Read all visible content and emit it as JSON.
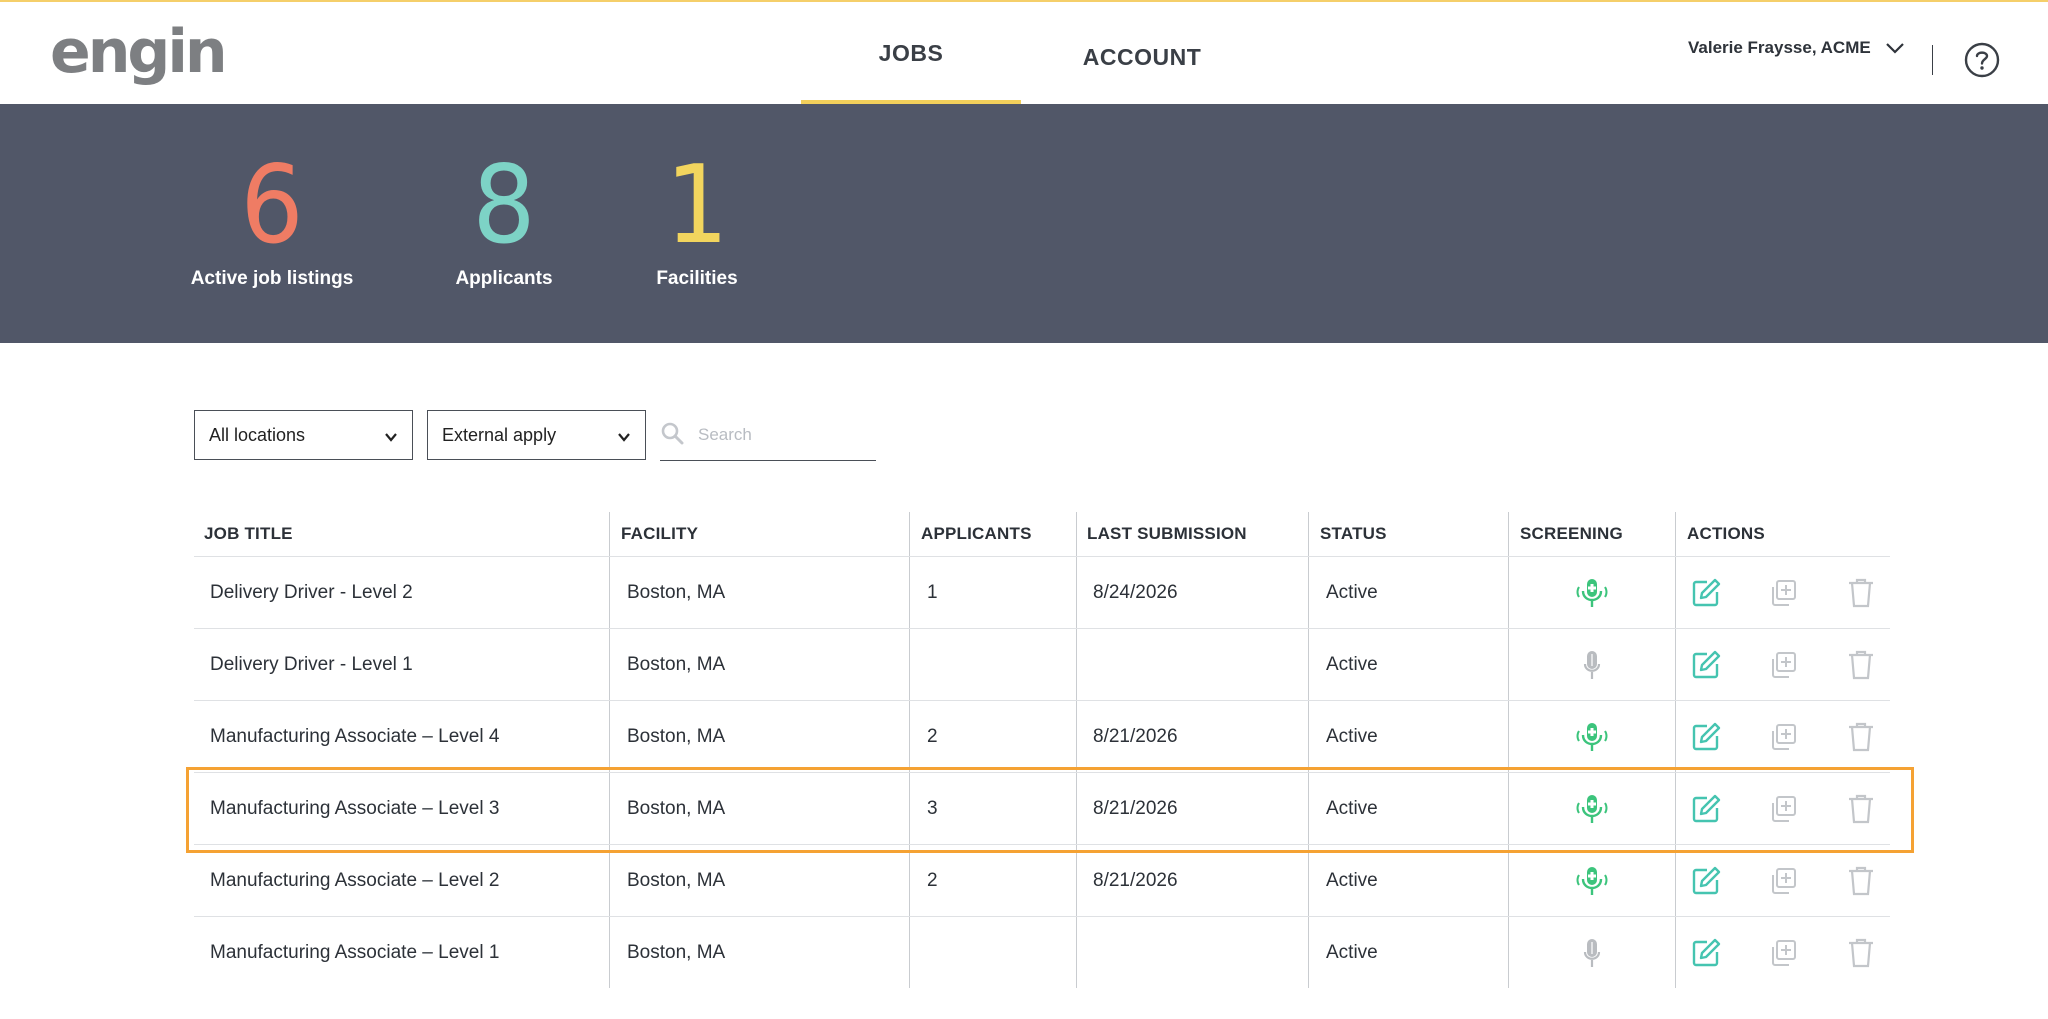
{
  "app": {
    "logo": "engin"
  },
  "nav": {
    "tabs": [
      {
        "label": "JOBS",
        "active": true
      },
      {
        "label": "ACCOUNT",
        "active": false
      }
    ]
  },
  "user": {
    "name": "Valerie Fraysse, ACME"
  },
  "stats": [
    {
      "value": "6",
      "label": "Active job listings",
      "color": "#ef7c64"
    },
    {
      "value": "8",
      "label": "Applicants",
      "color": "#7dd3c6"
    },
    {
      "value": "1",
      "label": "Facilities",
      "color": "#f2d55e"
    }
  ],
  "filters": {
    "location": "All locations",
    "apply_type": "External apply",
    "search_placeholder": "Search"
  },
  "table": {
    "headers": [
      "JOB TITLE",
      "FACILITY",
      "APPLICANTS",
      "LAST SUBMISSION",
      "STATUS",
      "SCREENING",
      "ACTIONS"
    ],
    "rows": [
      {
        "title": "Delivery Driver - Level 2",
        "facility": "Boston, MA",
        "applicants": "1",
        "last_submission": "8/24/2026",
        "status": "Active",
        "screening": "enabled"
      },
      {
        "title": "Delivery Driver - Level 1",
        "facility": "Boston, MA",
        "applicants": "",
        "last_submission": "",
        "status": "Active",
        "screening": "disabled"
      },
      {
        "title": "Manufacturing Associate – Level 4",
        "facility": "Boston, MA",
        "applicants": "2",
        "last_submission": "8/21/2026",
        "status": "Active",
        "screening": "enabled"
      },
      {
        "title": "Manufacturing Associate – Level 3",
        "facility": "Boston, MA",
        "applicants": "3",
        "last_submission": "8/21/2026",
        "status": "Active",
        "screening": "enabled"
      },
      {
        "title": "Manufacturing Associate – Level 2",
        "facility": "Boston, MA",
        "applicants": "2",
        "last_submission": "8/21/2026",
        "status": "Active",
        "screening": "enabled"
      },
      {
        "title": "Manufacturing Associate – Level 1",
        "facility": "Boston, MA",
        "applicants": "",
        "last_submission": "",
        "status": "Active",
        "screening": "disabled"
      }
    ],
    "highlighted_row": 3
  },
  "colors": {
    "accent": "#f2cf5b",
    "banner": "#515768",
    "highlight": "#f5a233",
    "screen_on": "#3cc47c",
    "screen_off": "#b9bcc0",
    "edit": "#45c4b0",
    "muted_icon": "#c3c6ca"
  },
  "icons": {
    "dropdown": "chevron-down-icon",
    "help": "help-circle-icon",
    "search": "search-icon",
    "screening": "microphone-icon",
    "edit": "edit-icon",
    "duplicate": "duplicate-icon",
    "delete": "trash-icon"
  }
}
